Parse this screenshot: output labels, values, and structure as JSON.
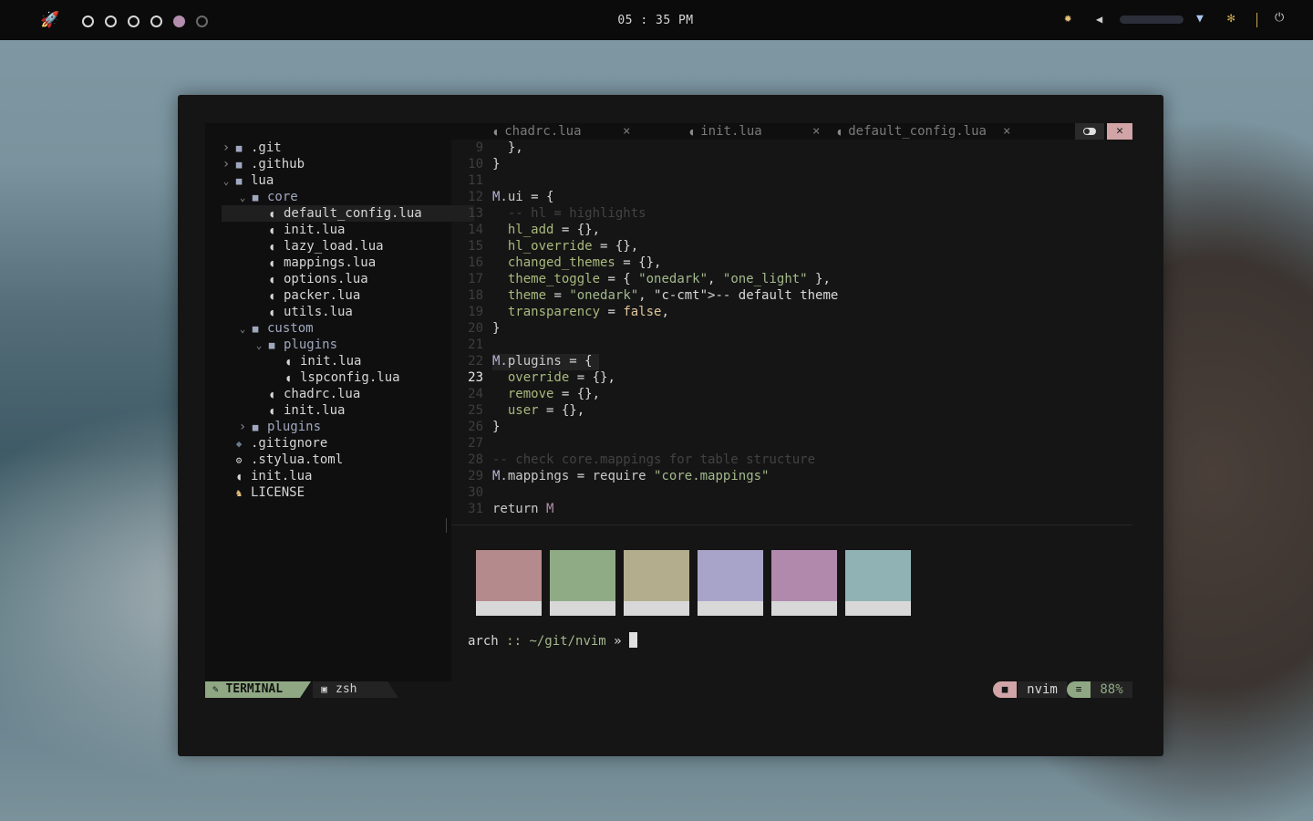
{
  "topbar": {
    "launcher_icon": "rocket-icon",
    "workspaces": [
      "empty",
      "empty",
      "empty",
      "empty",
      "active",
      "inactive"
    ],
    "clock": "05 : 35 PM",
    "icons": [
      "brightness-icon",
      "volume-icon",
      "wifi-icon",
      "settings-icon",
      "power-icon"
    ],
    "volume_level": 0.0
  },
  "tree": [
    {
      "label": ".git",
      "depth": 0,
      "kind": "folder",
      "expanded": false
    },
    {
      "label": ".github",
      "depth": 0,
      "kind": "folder",
      "expanded": false
    },
    {
      "label": "lua",
      "depth": 0,
      "kind": "folder",
      "expanded": true
    },
    {
      "label": "core",
      "depth": 1,
      "kind": "folder",
      "expanded": true
    },
    {
      "label": "default_config.lua",
      "depth": 2,
      "kind": "lua",
      "selected": true
    },
    {
      "label": "init.lua",
      "depth": 2,
      "kind": "lua"
    },
    {
      "label": "lazy_load.lua",
      "depth": 2,
      "kind": "lua"
    },
    {
      "label": "mappings.lua",
      "depth": 2,
      "kind": "lua"
    },
    {
      "label": "options.lua",
      "depth": 2,
      "kind": "lua"
    },
    {
      "label": "packer.lua",
      "depth": 2,
      "kind": "lua"
    },
    {
      "label": "utils.lua",
      "depth": 2,
      "kind": "lua"
    },
    {
      "label": "custom",
      "depth": 1,
      "kind": "folder",
      "expanded": true
    },
    {
      "label": "plugins",
      "depth": 2,
      "kind": "folder",
      "expanded": true
    },
    {
      "label": "init.lua",
      "depth": 3,
      "kind": "lua"
    },
    {
      "label": "lspconfig.lua",
      "depth": 3,
      "kind": "lua"
    },
    {
      "label": "chadrc.lua",
      "depth": 2,
      "kind": "lua"
    },
    {
      "label": "init.lua",
      "depth": 2,
      "kind": "lua"
    },
    {
      "label": "plugins",
      "depth": 1,
      "kind": "folder",
      "expanded": false
    },
    {
      "label": ".gitignore",
      "depth": 0,
      "kind": "git"
    },
    {
      "label": ".stylua.toml",
      "depth": 0,
      "kind": "gear"
    },
    {
      "label": "init.lua",
      "depth": 0,
      "kind": "lua"
    },
    {
      "label": "LICENSE",
      "depth": 0,
      "kind": "license"
    }
  ],
  "tabs": [
    {
      "label": "chadrc.lua",
      "close": "×"
    },
    {
      "label": "init.lua",
      "close": "×"
    },
    {
      "label": "default_config.lua",
      "close": "×"
    }
  ],
  "close_all_label": "✕",
  "code": {
    "current_line": "23",
    "lines": [
      {
        "n": "9",
        "t": "  },"
      },
      {
        "n": "10",
        "t": "}"
      },
      {
        "n": "11",
        "t": ""
      },
      {
        "n": "12",
        "t": "M.ui = {"
      },
      {
        "n": "13",
        "t": "  -- hl = highlights"
      },
      {
        "n": "14",
        "t": "  hl_add = {},"
      },
      {
        "n": "15",
        "t": "  hl_override = {},"
      },
      {
        "n": "16",
        "t": "  changed_themes = {},"
      },
      {
        "n": "17",
        "t": "  theme_toggle = { \"onedark\", \"one_light\" },"
      },
      {
        "n": "18",
        "t": "  theme = \"onedark\", -- default theme"
      },
      {
        "n": "19",
        "t": "  transparency = false,"
      },
      {
        "n": "20",
        "t": "}"
      },
      {
        "n": "21",
        "t": ""
      },
      {
        "n": "22",
        "t": "M.plugins = {"
      },
      {
        "n": "23",
        "t": "  override = {},"
      },
      {
        "n": "24",
        "t": "  remove = {},"
      },
      {
        "n": "25",
        "t": "  user = {},"
      },
      {
        "n": "26",
        "t": "}"
      },
      {
        "n": "27",
        "t": ""
      },
      {
        "n": "28",
        "t": "-- check core.mappings for table structure"
      },
      {
        "n": "29",
        "t": "M.mappings = require \"core.mappings\""
      },
      {
        "n": "30",
        "t": ""
      },
      {
        "n": "31",
        "t": "return M"
      }
    ]
  },
  "swatches": [
    "#b58a8c",
    "#8fab86",
    "#b3ad8d",
    "#a8a4c9",
    "#b189ad",
    "#91b2b4"
  ],
  "prompt": {
    "host": "arch",
    "sep": " :: ",
    "path": "~/git/nvim",
    "arrow": " » "
  },
  "statusline": {
    "mode": "TERMINAL",
    "shell": "zsh",
    "dir": "nvim",
    "percent": "88%"
  }
}
